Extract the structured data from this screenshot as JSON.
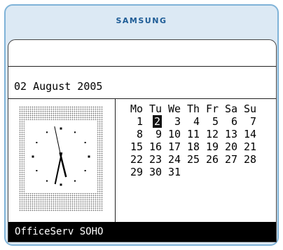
{
  "brand": "SAMSUNG",
  "date_line": "02 August 2005",
  "clock": {
    "hour": 5,
    "minute": 32,
    "second": 58
  },
  "calendar": {
    "weekdays": [
      "Mo",
      "Tu",
      "We",
      "Th",
      "Fr",
      "Sa",
      "Su"
    ],
    "weeks": [
      [
        "1",
        "2",
        "3",
        "4",
        "5",
        "6",
        "7"
      ],
      [
        "8",
        "9",
        "10",
        "11",
        "12",
        "13",
        "14"
      ],
      [
        "15",
        "16",
        "17",
        "18",
        "19",
        "20",
        "21"
      ],
      [
        "22",
        "23",
        "24",
        "25",
        "26",
        "27",
        "28"
      ],
      [
        "29",
        "30",
        "31",
        "",
        "",
        "",
        ""
      ]
    ],
    "selected_day": "2"
  },
  "status_text": "OfficeServ SOHO",
  "colors": {
    "brand": "#1e5c96",
    "frame": "#7fb3d8",
    "bezel": "#dce9f4"
  }
}
